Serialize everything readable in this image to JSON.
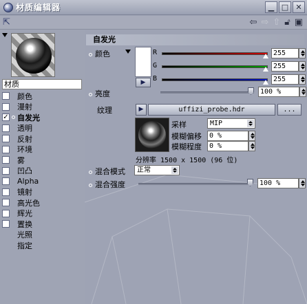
{
  "window": {
    "title": "材质编辑器"
  },
  "sidebar": {
    "material_name": "材质",
    "channels": [
      {
        "label": "颜色",
        "checked": false,
        "checkbox": true
      },
      {
        "label": "漫射",
        "checked": false,
        "checkbox": true
      },
      {
        "label": "自发光",
        "checked": true,
        "checkbox": true,
        "active": true
      },
      {
        "label": "透明",
        "checked": false,
        "checkbox": true
      },
      {
        "label": "反射",
        "checked": false,
        "checkbox": true
      },
      {
        "label": "环境",
        "checked": false,
        "checkbox": true
      },
      {
        "label": "雾",
        "checked": false,
        "checkbox": true
      },
      {
        "label": "凹凸",
        "checked": false,
        "checkbox": true
      },
      {
        "label": "Alpha",
        "checked": false,
        "checkbox": true
      },
      {
        "label": "镜射",
        "checked": false,
        "checkbox": true
      },
      {
        "label": "高光色",
        "checked": false,
        "checkbox": true
      },
      {
        "label": "辉光",
        "checked": false,
        "checkbox": true
      },
      {
        "label": "置换",
        "checked": false,
        "checkbox": true
      },
      {
        "label": "光照",
        "checked": false,
        "checkbox": false
      },
      {
        "label": "指定",
        "checked": false,
        "checkbox": false
      }
    ]
  },
  "panel": {
    "section_title": "自发光",
    "color_label": "颜色",
    "rgb": [
      {
        "letter": "R",
        "value": "255",
        "color": "#d10000"
      },
      {
        "letter": "G",
        "value": "255",
        "color": "#00a000"
      },
      {
        "letter": "B",
        "value": "255",
        "color": "#0010c0"
      }
    ],
    "brightness_label": "亮度",
    "brightness_value": "100 %",
    "texture_label": "纹理",
    "texture_file": "uffizi_probe.hdr",
    "texture_more": "...",
    "sampling_label": "采样",
    "sampling_value": "MIP",
    "blur_offset_label": "模糊偏移",
    "blur_offset_value": "0 %",
    "blur_scale_label": "模糊程度",
    "blur_scale_value": "0 %",
    "resolution_text": "分辨率 1500 x 1500 (96 位)",
    "mix_mode_label": "混合模式",
    "mix_mode_value": "正常",
    "mix_strength_label": "混合强度",
    "mix_strength_value": "100 %"
  },
  "colors": {
    "window_bg": "#9fa4b4",
    "title_text": "#ffffff"
  }
}
